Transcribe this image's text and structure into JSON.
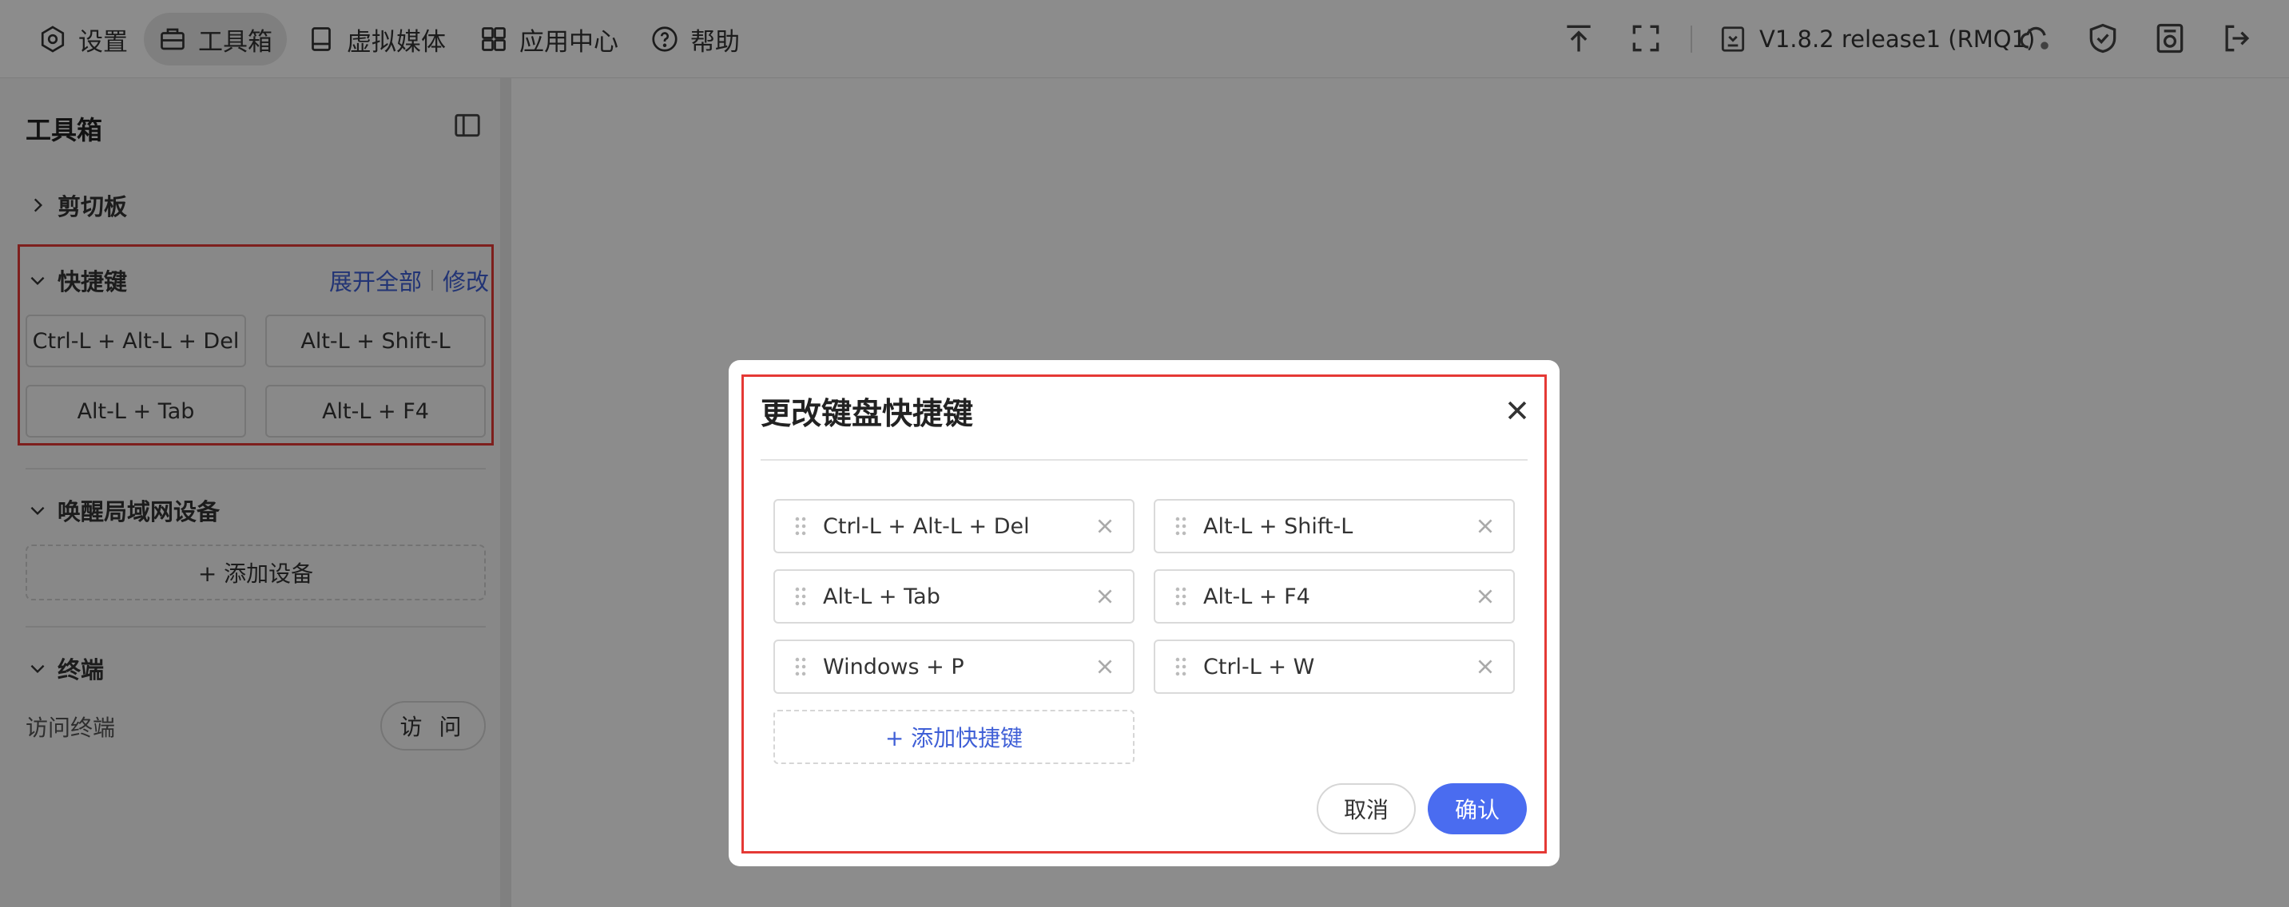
{
  "nav": {
    "items": [
      {
        "label": "设置",
        "icon": "gear-icon"
      },
      {
        "label": "工具箱",
        "icon": "toolbox-icon"
      },
      {
        "label": "虚拟媒体",
        "icon": "disk-icon"
      },
      {
        "label": "应用中心",
        "icon": "apps-icon"
      },
      {
        "label": "帮助",
        "icon": "help-icon"
      }
    ],
    "version": "V1.8.2 release1 (RMQ1)"
  },
  "sidebar": {
    "title": "工具箱",
    "clipboard": {
      "label": "剪切板"
    },
    "shortcuts": {
      "label": "快捷键",
      "expand_all": "展开全部",
      "edit": "修改",
      "keys": [
        "Ctrl-L + Alt-L + Del",
        "Alt-L + Shift-L",
        "Alt-L + Tab",
        "Alt-L + F4"
      ]
    },
    "wol": {
      "label": "唤醒局域网设备",
      "add_device": "+ 添加设备"
    },
    "terminal": {
      "label": "终端",
      "access_label": "访问终端",
      "visit_button": "访 问"
    }
  },
  "modal": {
    "title": "更改键盘快捷键",
    "shortcuts": [
      "Ctrl-L + Alt-L + Del",
      "Alt-L + Shift-L",
      "Alt-L + Tab",
      "Alt-L + F4",
      "Windows + P",
      "Ctrl-L + W"
    ],
    "add_shortcut": "+ 添加快捷键",
    "cancel": "取消",
    "confirm": "确认"
  },
  "colors": {
    "accent": "#4a6cf0",
    "link": "#3f5fd6",
    "highlight": "#e53935",
    "overlay": "rgba(0,0,0,0.45)"
  }
}
